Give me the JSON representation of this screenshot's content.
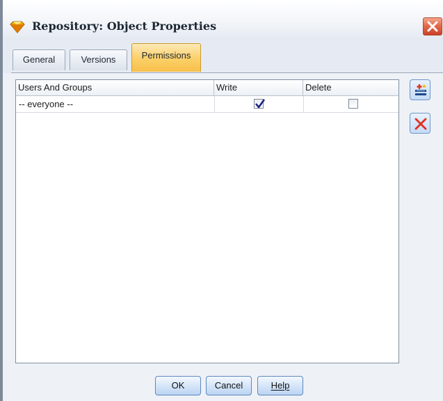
{
  "window": {
    "title": "Repository: Object Properties"
  },
  "icons": {
    "app": "diamond-app-icon",
    "close": "close-icon",
    "add": "add-user-icon",
    "remove": "delete-x-icon",
    "check": "checkmark-icon"
  },
  "colors": {
    "active_tab": "#fbcf67",
    "close_button": "#e46b4b",
    "remove_icon": "#e0301e",
    "button_border": "#5c87c0"
  },
  "tabs": [
    {
      "label": "General",
      "active": false
    },
    {
      "label": "Versions",
      "active": false
    },
    {
      "label": "Permissions",
      "active": true
    }
  ],
  "table": {
    "columns": [
      "Users And Groups",
      "Write",
      "Delete"
    ],
    "rows": [
      {
        "user": "-- everyone --",
        "write": true,
        "delete": false
      }
    ]
  },
  "buttons": {
    "ok": "OK",
    "cancel": "Cancel",
    "help": "Help"
  }
}
